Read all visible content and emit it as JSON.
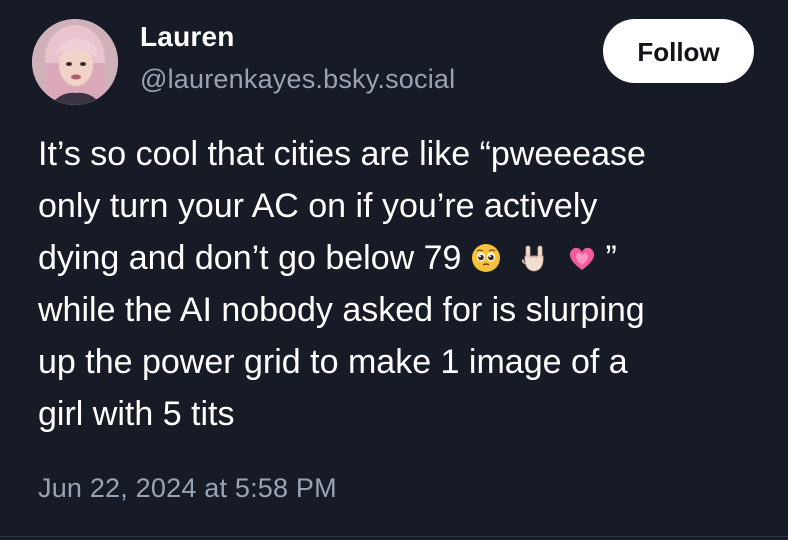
{
  "author": {
    "display_name": "Lauren",
    "handle": "@laurenkayes.bsky.social",
    "avatar_icon": "profile-photo"
  },
  "follow_button": {
    "label": "Follow"
  },
  "post": {
    "lines": [
      "It’s so cool that cities are like “pweeease",
      "only turn your AC on if you’re actively",
      "dying and don’t go below 79",
      "while the AI nobody asked for is slurping",
      "up the power grid to make 1 image of a",
      "girl with 5 tits"
    ],
    "emojis": [
      "pleading-face-emoji",
      "sign-of-horns-emoji",
      "growing-heart-emoji"
    ],
    "closing_quote": "”",
    "timestamp": "Jun 22, 2024 at 5:58 PM"
  },
  "colors": {
    "background": "#161b25",
    "text_primary": "#ffffff",
    "text_secondary": "#9aa3b2",
    "button_bg": "#ffffff",
    "button_text": "#111318"
  }
}
